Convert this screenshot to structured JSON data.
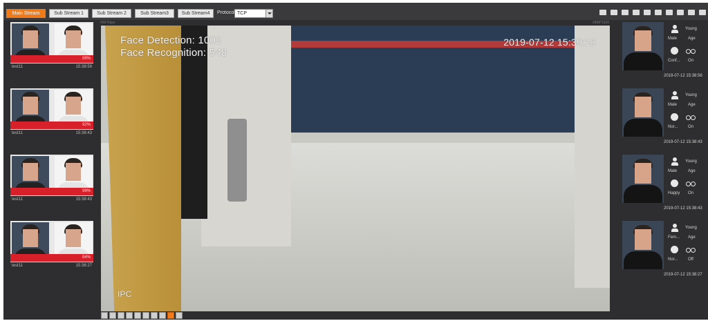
{
  "toolbar": {
    "tabs": [
      "Main Stream",
      "Sub Stream 1",
      "Sub Stream 2",
      "Sub Stream3",
      "Sub Stream4"
    ],
    "protocol_label": "Protocol",
    "protocol_value": "TCP"
  },
  "video": {
    "resolution_left": "4367kbps",
    "resolution_right": "2688*1520",
    "overlay": {
      "face_detection": "Face Detection: 1002",
      "face_recognition": "Face Recognition: 548",
      "timestamp": "2019-07-12 15:39:13",
      "channel_name": "IPC"
    }
  },
  "left_panel": [
    {
      "name": "test11",
      "time": "15:38:59",
      "similarity": "89%"
    },
    {
      "name": "test11",
      "time": "15:38:43",
      "similarity": "92%"
    },
    {
      "name": "test11",
      "time": "15:38:43",
      "similarity": "99%"
    },
    {
      "name": "test11",
      "time": "15:38:27",
      "similarity": "84%"
    }
  ],
  "right_panel": [
    {
      "age_group": "Young",
      "gender": "Male",
      "age_label": "Age",
      "expression": "Conf...",
      "glasses": "On",
      "time": "2019-07-12 15:38:56"
    },
    {
      "age_group": "Young",
      "gender": "Male",
      "age_label": "Age",
      "expression": "Nor...",
      "glasses": "On",
      "time": "2019-07-12 15:38:43"
    },
    {
      "age_group": "Young",
      "gender": "Male",
      "age_label": "Age",
      "expression": "Happy",
      "glasses": "On",
      "time": "2019-07-12 15:38:43"
    },
    {
      "age_group": "Young",
      "gender": "Fem...",
      "age_label": "Age",
      "expression": "Nor...",
      "glasses": "Off",
      "time": "2019-07-12 15:38:27"
    }
  ],
  "icons": {
    "toolbar_right": [
      "person-icon",
      "person-icon",
      "snapshot-icon",
      "record-icon",
      "display-icon",
      "camera-icon",
      "fullscreen-icon",
      "audio-icon",
      "speaker-icon",
      "info-icon"
    ],
    "bottom_bar": [
      "ptz-icon",
      "zoom-icon",
      "fit-icon",
      "ratio-icon",
      "grid-icon",
      "fluency-icon",
      "rules-icon",
      "overlay-icon",
      "face-icon",
      "snap-icon"
    ]
  },
  "colors": {
    "accent": "#f07a1a",
    "alarm_bar": "#d8202a",
    "panel_bg": "#2e2e30"
  }
}
